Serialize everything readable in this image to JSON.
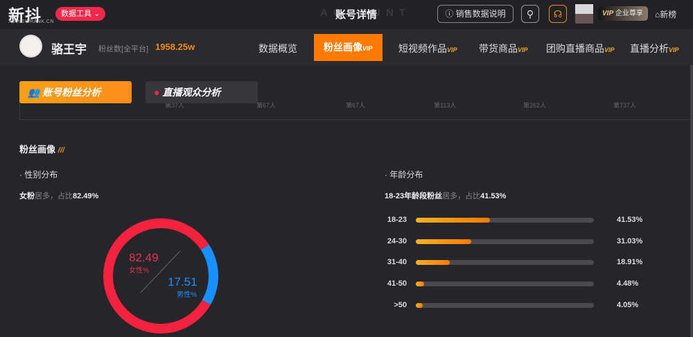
{
  "header": {
    "logo": "新抖",
    "logo_sub": "XD.NEWRANK.CN",
    "tools_label": "数据工具",
    "page_title": "账号详情",
    "ghost_text": "ACCOUNT",
    "sales_label": "销售数据说明",
    "vip_label": "VIP",
    "vip_text": "企业尊享",
    "newrank_label": "新榜"
  },
  "profile": {
    "name": "骆王宇",
    "fans_label": "粉丝数[全平台]",
    "fans_value": "1958.25w"
  },
  "nav": {
    "tabs": [
      {
        "label": "数据概览",
        "vip": ""
      },
      {
        "label": "粉丝画像",
        "vip": "VIP"
      },
      {
        "label": "短视频作品",
        "vip": "VIP"
      },
      {
        "label": "带货商品",
        "vip": "VIP"
      },
      {
        "label": "团购直播商品",
        "vip": "VIP"
      },
      {
        "label": "直播分析",
        "vip": "VIP"
      }
    ]
  },
  "subtabs": [
    "账号粉丝分析",
    "直播观众分析"
  ],
  "ranks": [
    "第37人",
    "第67人",
    "第67人",
    "第113人",
    "第262人",
    "第737人"
  ],
  "section_title": "粉丝画像",
  "gender": {
    "title": "性别分布",
    "summary_a": "女粉",
    "summary_b": "居多，占比",
    "summary_c": "82.49%",
    "female_value": "82.49",
    "female_label": "女性%",
    "male_value": "17.51",
    "male_label": "男性%",
    "female_color": "#f5223f",
    "male_color": "#1890ff"
  },
  "age": {
    "title": "年龄分布",
    "summary_a": "18-23年龄段粉丝",
    "summary_b": "居多，占比",
    "summary_c": "41.53%",
    "rows": [
      {
        "label": "18-23",
        "value": 41.53,
        "text": "41.53%"
      },
      {
        "label": "24-30",
        "value": 31.03,
        "text": "31.03%"
      },
      {
        "label": "31-40",
        "value": 18.91,
        "text": "18.91%"
      },
      {
        "label": "41-50",
        "value": 4.48,
        "text": "4.48%"
      },
      {
        "label": ">50",
        "value": 4.05,
        "text": "4.05%"
      }
    ]
  }
}
